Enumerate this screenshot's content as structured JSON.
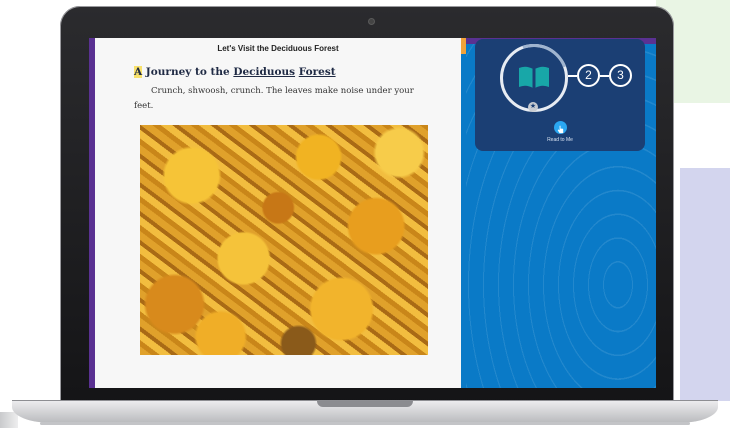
{
  "reader": {
    "title": "Let's Visit the Deciduous Forest",
    "heading_first_letter": "A",
    "heading_middle": " Journey to the ",
    "heading_word1": "Deciduous",
    "heading_word2": "Forest",
    "body": "Crunch, shwoosh, crunch. The leaves make noise under your feet."
  },
  "progress": {
    "steps": [
      "2",
      "3"
    ],
    "read_label": "Read to Me"
  },
  "icons": {
    "book": "open-book-icon",
    "trophy": "trophy-icon",
    "read": "hand-pointer-icon"
  },
  "colors": {
    "panel": "#1b3f74",
    "background": "#0a7ac7",
    "accent": "#f8e16c",
    "read_button": "#2aa7f2"
  }
}
